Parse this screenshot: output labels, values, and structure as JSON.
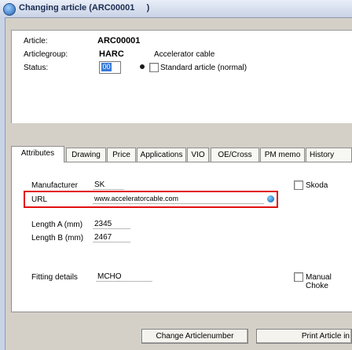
{
  "window": {
    "title": "Changing article (ARC00001     )"
  },
  "header": {
    "article_label": "Article:",
    "article_value": "ARC00001",
    "group_label": "Articlegroup:",
    "group_code": "HARC",
    "group_name": "Accelerator cable",
    "status_label": "Status:",
    "status_code": "00",
    "status_text": "Standard article (normal)"
  },
  "tabs": [
    {
      "label": "Attributes"
    },
    {
      "label": "Drawing"
    },
    {
      "label": "Price"
    },
    {
      "label": "Applications"
    },
    {
      "label": "VIO"
    },
    {
      "label": "OE/Cross"
    },
    {
      "label": "PM memo"
    },
    {
      "label": "History"
    }
  ],
  "attributes": {
    "manufacturer_label": "Manufacturer",
    "manufacturer_code": "SK",
    "manufacturer_name": "Skoda",
    "url_label": "URL",
    "url_value": "www.acceleratorcable.com",
    "length_a_label": "Length A (mm)",
    "length_a_value": "2345",
    "length_b_label": "Length B (mm)",
    "length_b_value": "2467",
    "fitting_label": "Fitting details",
    "fitting_value": "MCHO",
    "manual_choke_label": "Manual Choke"
  },
  "buttons": {
    "change_articlenumber": "Change Articlenumber",
    "print_article": "Print Article in"
  }
}
